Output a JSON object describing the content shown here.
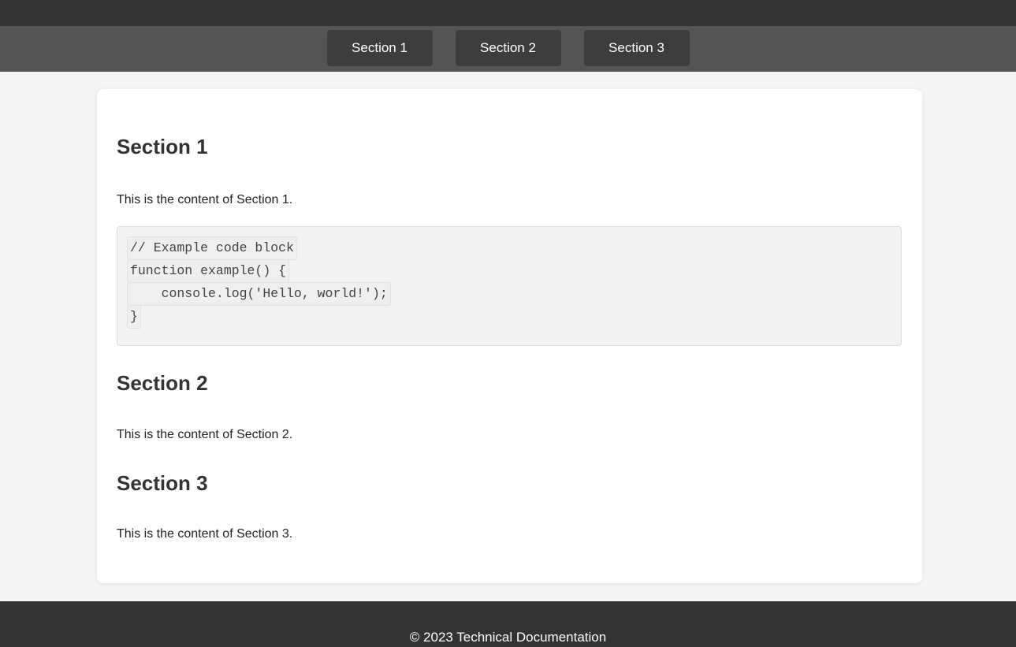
{
  "nav": {
    "items": [
      {
        "label": "Section 1"
      },
      {
        "label": "Section 2"
      },
      {
        "label": "Section 3"
      }
    ]
  },
  "sections": [
    {
      "title": "Section 1",
      "text": "This is the content of Section 1.",
      "code_lines": [
        "// Example code block",
        "function example() {",
        "    console.log('Hello, world!');",
        "}"
      ]
    },
    {
      "title": "Section 2",
      "text": "This is the content of Section 2."
    },
    {
      "title": "Section 3",
      "text": "This is the content of Section 3."
    }
  ],
  "footer": {
    "text": "© 2023 Technical Documentation"
  },
  "colors": {
    "topbar": "#333333",
    "navbar": "#555555",
    "nav_button": "#3d3d3d",
    "page_background": "#f5f5f5",
    "card_background": "#ffffff",
    "footer": "#333333"
  }
}
